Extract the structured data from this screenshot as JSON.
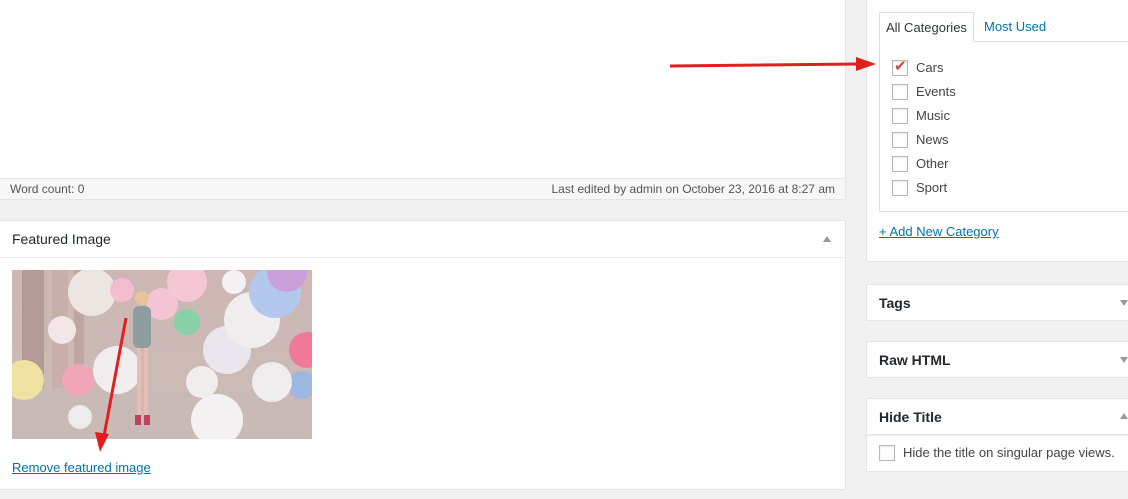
{
  "editor": {
    "word_count": "Word count: 0",
    "last_edited": "Last edited by admin on October 23, 2016 at 8:27 am"
  },
  "featured_image": {
    "title": "Featured Image",
    "remove_link": "Remove featured image"
  },
  "categories": {
    "tabs": [
      "All Categories",
      "Most Used"
    ],
    "items": [
      {
        "label": "Cars",
        "checked": true
      },
      {
        "label": "Events",
        "checked": false
      },
      {
        "label": "Music",
        "checked": false
      },
      {
        "label": "News",
        "checked": false
      },
      {
        "label": "Other",
        "checked": false
      },
      {
        "label": "Sport",
        "checked": false
      }
    ],
    "add_new": "+ Add New Category"
  },
  "sidebar_boxes": {
    "tags": "Tags",
    "raw_html": "Raw HTML",
    "hide_title": "Hide Title",
    "hide_title_option": "Hide the title on singular page views."
  },
  "colors": {
    "link": "#0073aa",
    "annotation_arrow": "#e02020",
    "check_mark": "#d6453f"
  },
  "icons": {
    "check": "checkmark-icon",
    "collapse": "triangle-up-icon",
    "expand": "triangle-down-icon"
  }
}
